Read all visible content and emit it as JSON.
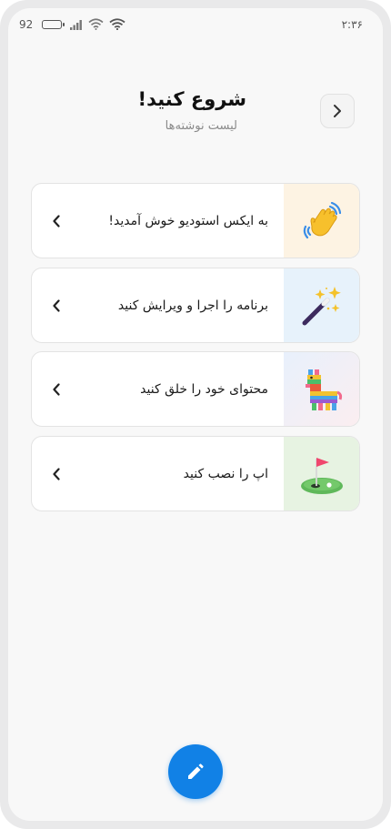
{
  "status_bar": {
    "battery_percent": "92",
    "time": "۲:۳۶",
    "icons": [
      "battery-icon",
      "signal-icon",
      "wifi-icon",
      "wifi-icon"
    ]
  },
  "header": {
    "title": "شروع کنید!",
    "subtitle": "لیست نوشته‌ها",
    "back_icon": "chevron-right-icon"
  },
  "cards": [
    {
      "label": "به ایکس استودیو خوش آمدید!",
      "icon": "waving-hand-icon"
    },
    {
      "label": "برنامه را اجرا و ویرایش کنید",
      "icon": "magic-wand-icon"
    },
    {
      "label": "محتوای خود را خلق کنید",
      "icon": "pinata-icon"
    },
    {
      "label": "اپ را نصب کنید",
      "icon": "golf-flag-icon"
    }
  ],
  "fab": {
    "icon": "pencil-icon"
  },
  "colors": {
    "accent": "#1181e6",
    "background": "#f8f8f8",
    "card_border": "#e3e3e3"
  }
}
